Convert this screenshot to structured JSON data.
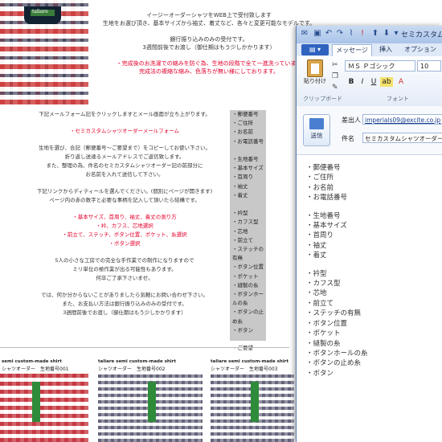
{
  "web": {
    "brand": "taliare",
    "intro_lines": [
      "イージーオーダーシャツをWEB上で受付致します",
      "生地をお選び頂き、基本サイズから袖丈、着丈など、各々と変更可能なモデルです。",
      "",
      "銀行振り込みのみの受付です。",
      "3週間前後でお渡し（御仕期はもう少しかかります）"
    ],
    "intro_red_lines": [
      "・完成後のお洗濯での縮みを防ぐ為、生地の段階で全て一進洗っています",
      "完成法の複縮な縮み、色落ちが無い様にしております。"
    ],
    "mail_lines_1": [
      "下記メールフォーム記をクリックしますとメール画面が立ち上がります。"
    ],
    "mail_form_title": "・セミカスタムシャツオーダーメールフォーム",
    "mail_lines_2": [
      "生地を選び、合記（郵便番号～ご要望まで）をコピーしてお使い下さい。",
      "折り返し送達るメールアドレスでご返信致します。",
      "また、整理の為、件名のセミカスタムシャツオーダー記の前部分に",
      "お名前を入れて送信して下さい。",
      "",
      "下記リンクからディティールを選んでください。(個別にページが開きます)",
      "ページ内の赤の数字と必要な事柄を記入して頂いたら結構です。"
    ],
    "red_links": [
      "・基本サイズ、首周り、袖丈、着丈の測り方",
      "・衿、カフス、芯地選択",
      "・前立て、ステッチ、ボタン位置、ポケット、糸選択",
      "・ボタン選択"
    ],
    "mail_lines_3": [
      "5人の小さな工房での完全な手作業での制作になりますので",
      "ミリ単位の極作業が出る可能性もあります。",
      "何卒ご了承下さいませ。",
      "",
      "では、何か分からないことがありましたら気軽にお問い合わせ下さい。",
      "また、お支払い方法は銀行振り込みのみの受付です。",
      "3週間前後でお渡し（御仕期はもう少しかかります）"
    ],
    "sidebar_items": [
      "・郵便番号",
      "・ご住所",
      "・お名前",
      "・お電話番号",
      "",
      "・生地番号",
      "・基本サイズ",
      "・首周り",
      "・袖丈",
      "・着丈",
      "",
      "・衿型",
      "・カフス型",
      "・芯地",
      "・前立て",
      "・ステッチの有無",
      "・ボタン位置",
      "・ポケット",
      "・縫製の糸",
      "・ボタンホールの糸",
      "・ボタンの止め糸",
      "・ボタン",
      "",
      "・ご要望"
    ],
    "captions": [
      {
        "title": "semi custom-made shirt",
        "sub": "シャツオーダー　生地番号001"
      },
      {
        "title": "taliare semi custom-made shirt",
        "sub": "シャツオーダー　生地番号002"
      },
      {
        "title": "taliare semi custom-made shirt",
        "sub": "シャツオーダー　生地番号003"
      }
    ]
  },
  "outlook": {
    "title": "セミカスタムシ",
    "tabs": {
      "file": "",
      "message": "メッセージ",
      "insert": "挿入",
      "options": "オプション"
    },
    "clipboard": {
      "paste": "貼り付け",
      "group": "クリップボード"
    },
    "font": {
      "name": "ＭＳ Ｐゴシック",
      "size": "10",
      "group": "フォント"
    },
    "format_buttons": [
      "B",
      "I",
      "U",
      "ab"
    ],
    "send_label": "送信",
    "from_label": "差出人",
    "from_value": "imperials09@excite.co.jp",
    "subject_label": "件名",
    "subject_value": "セミカスタムシャツオーダー",
    "body_groups": [
      [
        "・郵便番号",
        "・ご住所",
        "・お名前",
        "・お電話番号"
      ],
      [
        "・生地番号",
        "・基本サイズ",
        "・首周り",
        "・袖丈",
        "・着丈"
      ],
      [
        "・衿型",
        "・カフス型",
        "・芯地",
        "・前立て",
        "・ステッチの有無",
        "・ボタン位置",
        "・ポケット",
        "・縫製の糸",
        "・ボタンホールの糸",
        "・ボタンの止め糸",
        "・ボタン"
      ]
    ]
  }
}
